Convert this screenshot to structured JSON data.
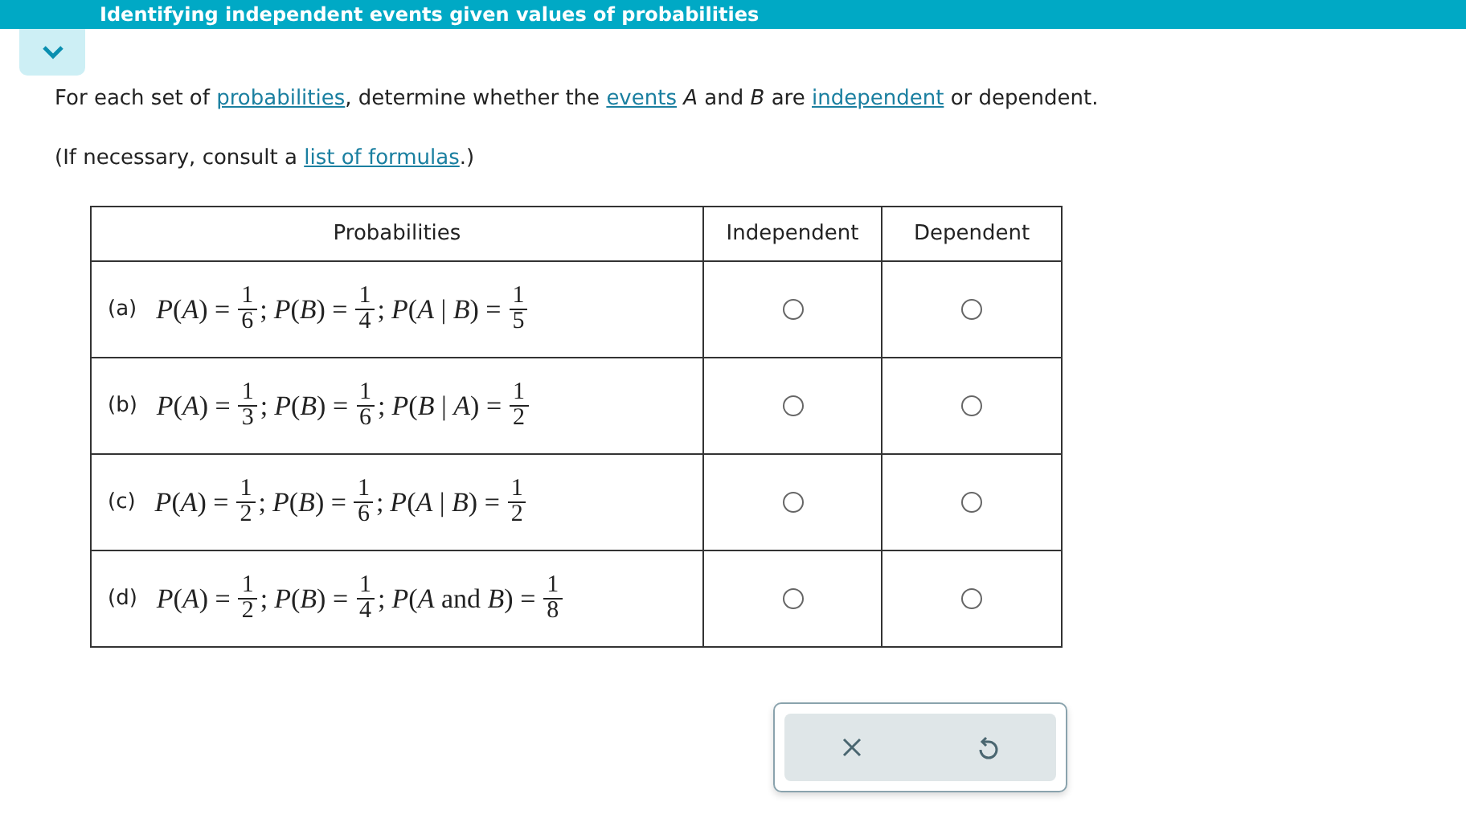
{
  "header": {
    "title": "Identifying independent events given values of probabilities"
  },
  "intro": [
    {
      "kind": "text",
      "text": "For each set of "
    },
    {
      "kind": "link",
      "text": "probabilities"
    },
    {
      "kind": "text",
      "text": ", determine whether the "
    },
    {
      "kind": "link",
      "text": "events"
    },
    {
      "kind": "text",
      "text": " *A* and *B* are "
    },
    {
      "kind": "link",
      "text": "independent"
    },
    {
      "kind": "text",
      "text": " or dependent."
    }
  ],
  "note": [
    {
      "kind": "text",
      "text": "(If necessary, consult a "
    },
    {
      "kind": "link",
      "text": "list of formulas"
    },
    {
      "kind": "text",
      "text": ".)"
    }
  ],
  "table": {
    "columns": [
      "Probabilities",
      "Independent",
      "Dependent"
    ],
    "rows": [
      {
        "label": "(a)",
        "terms": [
          {
            "lhs": "*P*(*A*) =",
            "num": "1",
            "den": "6",
            "punct": ";"
          },
          {
            "lhs": "*P*(*B*) =",
            "num": "1",
            "den": "4",
            "punct": ";"
          },
          {
            "lhs": "*P*(*A* | *B*) =",
            "num": "1",
            "den": "5"
          }
        ],
        "choices": [
          {
            "selected": false
          },
          {
            "selected": false
          }
        ]
      },
      {
        "label": "(b)",
        "terms": [
          {
            "lhs": "*P*(*A*) =",
            "num": "1",
            "den": "3",
            "punct": ";"
          },
          {
            "lhs": "*P*(*B*) =",
            "num": "1",
            "den": "6",
            "punct": ";"
          },
          {
            "lhs": "*P*(*B* | *A*) =",
            "num": "1",
            "den": "2"
          }
        ],
        "choices": [
          {
            "selected": false
          },
          {
            "selected": false
          }
        ]
      },
      {
        "label": "(c)",
        "terms": [
          {
            "lhs": "*P*(*A*) =",
            "num": "1",
            "den": "2",
            "punct": ";"
          },
          {
            "lhs": "*P*(*B*) =",
            "num": "1",
            "den": "6",
            "punct": ";"
          },
          {
            "lhs": "*P*(*A* | *B*) =",
            "num": "1",
            "den": "2"
          }
        ],
        "choices": [
          {
            "selected": false
          },
          {
            "selected": false
          }
        ]
      },
      {
        "label": "(d)",
        "terms": [
          {
            "lhs": "*P*(*A*) =",
            "num": "1",
            "den": "2",
            "punct": ";"
          },
          {
            "lhs": "*P*(*B*) =",
            "num": "1",
            "den": "4",
            "punct": ";"
          },
          {
            "lhs": "*P*(*A* and *B*) =",
            "num": "1",
            "den": "8"
          }
        ],
        "choices": [
          {
            "selected": false
          },
          {
            "selected": false
          }
        ]
      }
    ]
  },
  "actions": [
    {
      "kind": "clear"
    },
    {
      "kind": "undo"
    }
  ]
}
